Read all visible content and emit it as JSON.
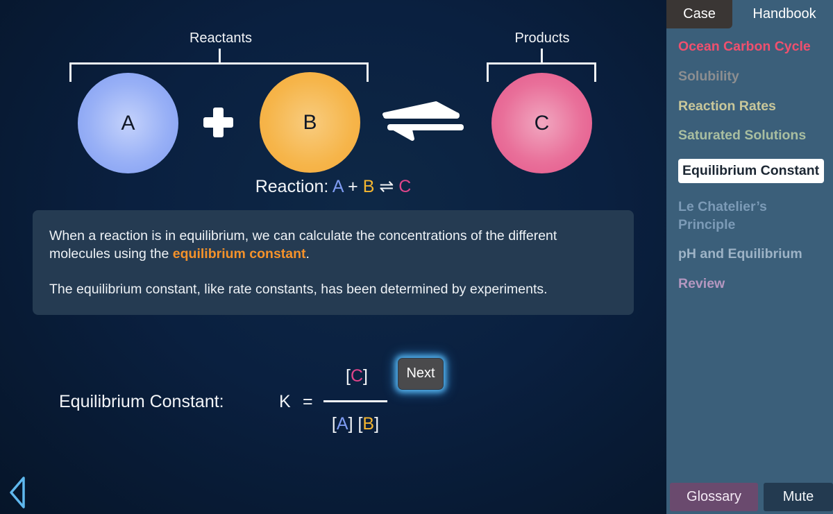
{
  "diagram": {
    "reactants_label": "Reactants",
    "products_label": "Products",
    "molecules": [
      {
        "id": "A",
        "label": "A",
        "color": "#7f9cf2"
      },
      {
        "id": "B",
        "label": "B",
        "color": "#f5b630"
      },
      {
        "id": "C",
        "label": "C",
        "color": "#e0458a"
      }
    ],
    "plus_icon": "plus-icon",
    "arrow_icon": "equilibrium-arrows-icon",
    "reaction": {
      "prefix": "Reaction: ",
      "a": "A",
      "plus": " + ",
      "b": "B",
      "arrow": " ⇌ ",
      "c": "C"
    }
  },
  "info": {
    "paragraph1_before": "When a reaction is in equilibrium, we can calculate the concentrations of the different molecules using the ",
    "paragraph1_highlight": "equilibrium constant",
    "paragraph1_after": ".",
    "paragraph2": "The equilibrium constant, like rate constants, has been determined by experiments.",
    "highlight_color": "#f5922a"
  },
  "equation": {
    "label": "Equilibrium Constant:",
    "k": "K",
    "equals": "=",
    "numerator": {
      "open": "[",
      "c": "C",
      "close": "]"
    },
    "denominator": {
      "open_a": "[",
      "a": "A",
      "close_a": "]",
      "space": " ",
      "open_b": "[",
      "b": "B",
      "close_b": "]"
    }
  },
  "next_button": {
    "label": "Next"
  },
  "back_button": {
    "icon": "back-triangle-icon",
    "color": "#5fb8ee"
  },
  "sidebar": {
    "tabs": [
      {
        "label": "Case",
        "active": true
      },
      {
        "label": "Handbook",
        "active": false
      }
    ],
    "items": [
      {
        "label": "Ocean Carbon Cycle",
        "color": "#f0506e"
      },
      {
        "label": "Solubility",
        "color": "#8c8e90"
      },
      {
        "label": "Reaction Rates",
        "color": "#c9c79a"
      },
      {
        "label": "Saturated Solutions",
        "color": "#a9bea0"
      },
      {
        "label": "Equilibrium Constant",
        "color": "#1c2733",
        "selected": true
      },
      {
        "label": "Le Chatelier’s Principle",
        "color": "#7c9bb7"
      },
      {
        "label": "pH and Equilibrium",
        "color": "#9db3c6"
      },
      {
        "label": "Review",
        "color": "#b497c0"
      }
    ],
    "glossary_label": "Glossary",
    "mute_label": "Mute"
  }
}
